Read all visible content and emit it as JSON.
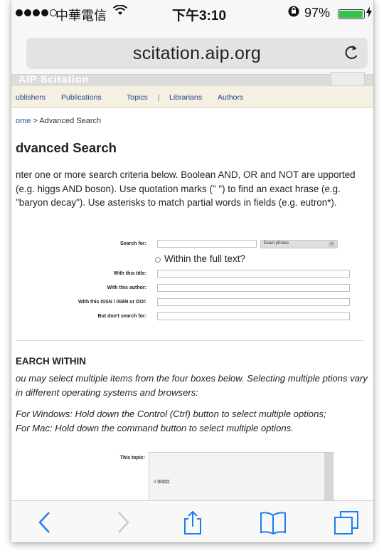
{
  "status": {
    "carrier": "中華電信",
    "time": "下午3:10",
    "battery": "97%",
    "battery_level": 0.97
  },
  "browser": {
    "url": "scitation.aip.org"
  },
  "site": {
    "banner": "AIP Scitation",
    "nav": [
      "ublishers",
      "Publications",
      "Topics",
      "|",
      "Librarians",
      "Authors"
    ]
  },
  "breadcrumb": {
    "home": "ome",
    "separator": " > ",
    "current": "Advanced Search"
  },
  "page_title": "dvanced Search",
  "intro": "nter one or more search criteria below. Boolean AND, OR and NOT are upported (e.g. higgs AND boson). Use quotation marks (\" \") to find an exact hrase (e.g. \"baryon decay\"). Use asterisks to match partial words in fields (e.g. eutron*).",
  "form": {
    "search_for_label": "Search for:",
    "match_select": "Exact phrase",
    "full_text_label": "Within the full text?",
    "title_label": "With this title:",
    "author_label": "With this author:",
    "issn_label": "With this ISSN / ISBN or DOI:",
    "exclude_label": "But don't search for:"
  },
  "search_within": {
    "heading": "EARCH WITHIN",
    "para1": "ou may select multiple items from the four boxes below. Selecting multiple ptions vary in different operating systems and browsers:",
    "windows": "For Windows: Hold down the Control (Ctrl) button to select multiple options;",
    "mac": "For Mac: Hold down the command button to select multiple options.",
    "topic_label": "This topic:",
    "topic_count": "0 個項目"
  }
}
